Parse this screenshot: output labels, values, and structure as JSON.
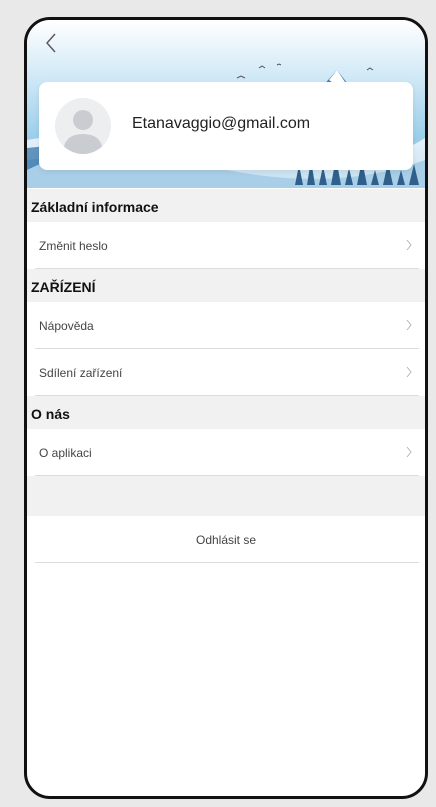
{
  "header": {
    "back_icon": "chevron-left-icon"
  },
  "profile": {
    "email": "Etanavaggio@gmail.com",
    "avatar_icon": "user-avatar-icon"
  },
  "sections": [
    {
      "title": "Základní informace",
      "items": [
        {
          "label": "Změnit heslo"
        }
      ]
    },
    {
      "title": "ZAŘÍZENÍ",
      "items": [
        {
          "label": "Nápověda"
        },
        {
          "label": "Sdílení zařízení"
        }
      ]
    },
    {
      "title": "O nás",
      "items": [
        {
          "label": "O aplikaci"
        }
      ]
    }
  ],
  "logout_label": "Odhlásit se",
  "colors": {
    "sky": "#7fc2e8",
    "section_bg": "#f1f1f1",
    "divider": "#dcdcdc",
    "frame": "#111111"
  }
}
